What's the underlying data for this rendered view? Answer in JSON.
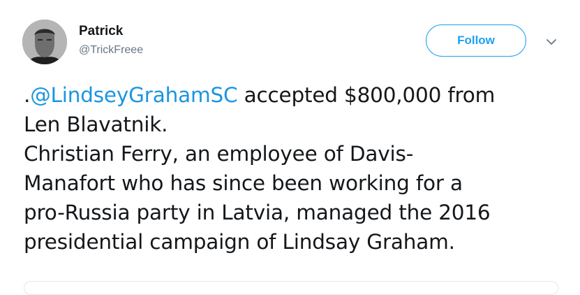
{
  "user": {
    "display_name": "Patrick",
    "handle": "@TrickFreee"
  },
  "actions": {
    "follow_label": "Follow"
  },
  "icons": {
    "caret": "chevron-down-icon",
    "avatar": "profile-photo"
  },
  "tweet": {
    "prefix": ".",
    "mention": "@LindseyGrahamSC",
    "line1_rest": " accepted $800,000 from",
    "lines": [
      "Len Blavatnik.",
      "Christian Ferry, an employee of Davis-",
      "Manafort who has since been working for a",
      "pro-Russia party in Latvia, managed the 2016",
      "presidential campaign of Lindsay Graham."
    ]
  },
  "colors": {
    "accent": "#1da1f2",
    "mention": "#1b95e0",
    "text": "#14171a",
    "secondary": "#657786"
  }
}
